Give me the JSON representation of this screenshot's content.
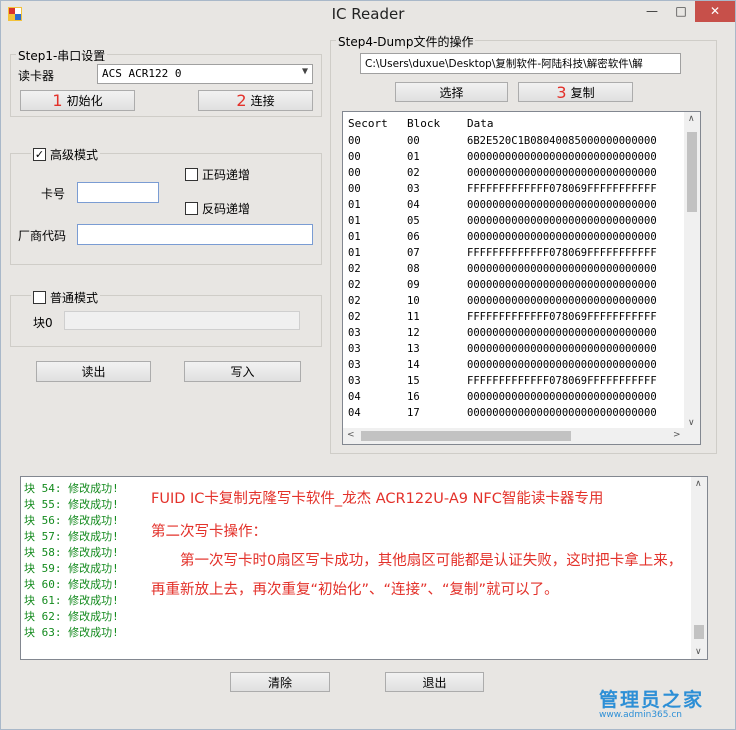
{
  "window": {
    "title": "IC Reader"
  },
  "titlebar": {
    "minimize": "—",
    "maximize": "□",
    "close": "✕"
  },
  "step1": {
    "legend": "Step1-串口设置",
    "reader_label": "读卡器",
    "reader_value": "ACS ACR122 0",
    "init_num": "1",
    "init_label": "初始化",
    "connect_num": "2",
    "connect_label": "连接"
  },
  "advanced": {
    "label": "高级模式",
    "checked": "✓",
    "card_label": "卡号",
    "card_value": "",
    "inc_label": "正码递增",
    "dec_label": "反码递增",
    "vendor_label": "厂商代码",
    "vendor_value": ""
  },
  "normal": {
    "label": "普通模式",
    "block0_label": "块0",
    "block0_value": ""
  },
  "actions": {
    "read_label": "读出",
    "write_label": "写入"
  },
  "step4": {
    "legend": "Step4-Dump文件的操作",
    "path": "C:\\Users\\duxue\\Desktop\\复制软件-阿陆科技\\解密软件\\解",
    "select_label": "选择",
    "copy_num": "3",
    "copy_label": "复制"
  },
  "table": {
    "headers": [
      "Secort",
      "Block",
      "Data"
    ],
    "rows": [
      [
        "00",
        "00",
        "6B2E520C1B08040085000000000000"
      ],
      [
        "00",
        "01",
        "000000000000000000000000000000"
      ],
      [
        "00",
        "02",
        "000000000000000000000000000000"
      ],
      [
        "00",
        "03",
        "FFFFFFFFFFFFF078069FFFFFFFFFFF"
      ],
      [
        "01",
        "04",
        "000000000000000000000000000000"
      ],
      [
        "01",
        "05",
        "000000000000000000000000000000"
      ],
      [
        "01",
        "06",
        "000000000000000000000000000000"
      ],
      [
        "01",
        "07",
        "FFFFFFFFFFFFF078069FFFFFFFFFFF"
      ],
      [
        "02",
        "08",
        "000000000000000000000000000000"
      ],
      [
        "02",
        "09",
        "000000000000000000000000000000"
      ],
      [
        "02",
        "10",
        "000000000000000000000000000000"
      ],
      [
        "02",
        "11",
        "FFFFFFFFFFFFF078069FFFFFFFFFFF"
      ],
      [
        "03",
        "12",
        "000000000000000000000000000000"
      ],
      [
        "03",
        "13",
        "000000000000000000000000000000"
      ],
      [
        "03",
        "14",
        "000000000000000000000000000000"
      ],
      [
        "03",
        "15",
        "FFFFFFFFFFFFF078069FFFFFFFFFFF"
      ],
      [
        "04",
        "16",
        "000000000000000000000000000000"
      ],
      [
        "04",
        "17",
        "000000000000000000000000000000"
      ]
    ]
  },
  "log": {
    "lines": [
      "块 54: 修改成功!",
      "块 55: 修改成功!",
      "块 56: 修改成功!",
      "块 57: 修改成功!",
      "块 58: 修改成功!",
      "块 59: 修改成功!",
      "块 60: 修改成功!",
      "块 61: 修改成功!",
      "块 62: 修改成功!",
      "块 63: 修改成功!"
    ],
    "note_title": "FUID IC卡复制克隆写卡软件_龙杰 ACR122U-A9 NFC智能读卡器专用",
    "note_heading": "第二次写卡操作：",
    "note_body": "第一次写卡时0扇区写卡成功，其他扇区可能都是认证失败，这时把卡拿上来，再重新放上去，再次重复“初始化”、“连接”、“复制”就可以了。"
  },
  "bottom": {
    "clear_label": "清除",
    "exit_label": "退出"
  },
  "watermark": {
    "name": "管理员之家",
    "url": "www.admin365.cn"
  },
  "colors": {
    "accent_red": "#e3312a",
    "log_green": "#138a1d",
    "close_red": "#c7504a",
    "watermark_blue": "#2d8fd6"
  }
}
